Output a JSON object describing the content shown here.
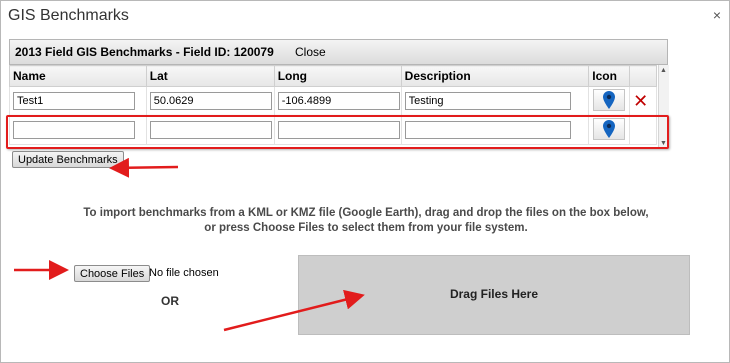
{
  "dialog": {
    "title": "GIS Benchmarks",
    "close_glyph": "×"
  },
  "panel": {
    "title": "2013 Field GIS Benchmarks - Field ID: 120079",
    "close_label": "Close"
  },
  "grid": {
    "columns": [
      "Name",
      "Lat",
      "Long",
      "Description",
      "Icon"
    ],
    "rows": [
      {
        "name": "Test1",
        "lat": "50.0629",
        "long": "-106.4899",
        "description": "Testing",
        "icon": "map-pin-icon",
        "deletable": true
      },
      {
        "name": "",
        "lat": "",
        "long": "",
        "description": "",
        "icon": "map-pin-icon",
        "deletable": false
      }
    ]
  },
  "actions": {
    "update_label": "Update Benchmarks"
  },
  "import": {
    "line1": "To import benchmarks from a KML or KMZ file (Google Earth), drag and drop the files on the box below,",
    "line2": "or press Choose Files to select them from your file system.",
    "choose_label": "Choose Files",
    "file_status": "No file chosen",
    "or_label": "OR",
    "drop_label": "Drag Files Here"
  },
  "colors": {
    "highlight": "#e21c1c",
    "pin": "#1565c0",
    "delete": "#c00000",
    "dropzone": "#cfcfcf"
  }
}
